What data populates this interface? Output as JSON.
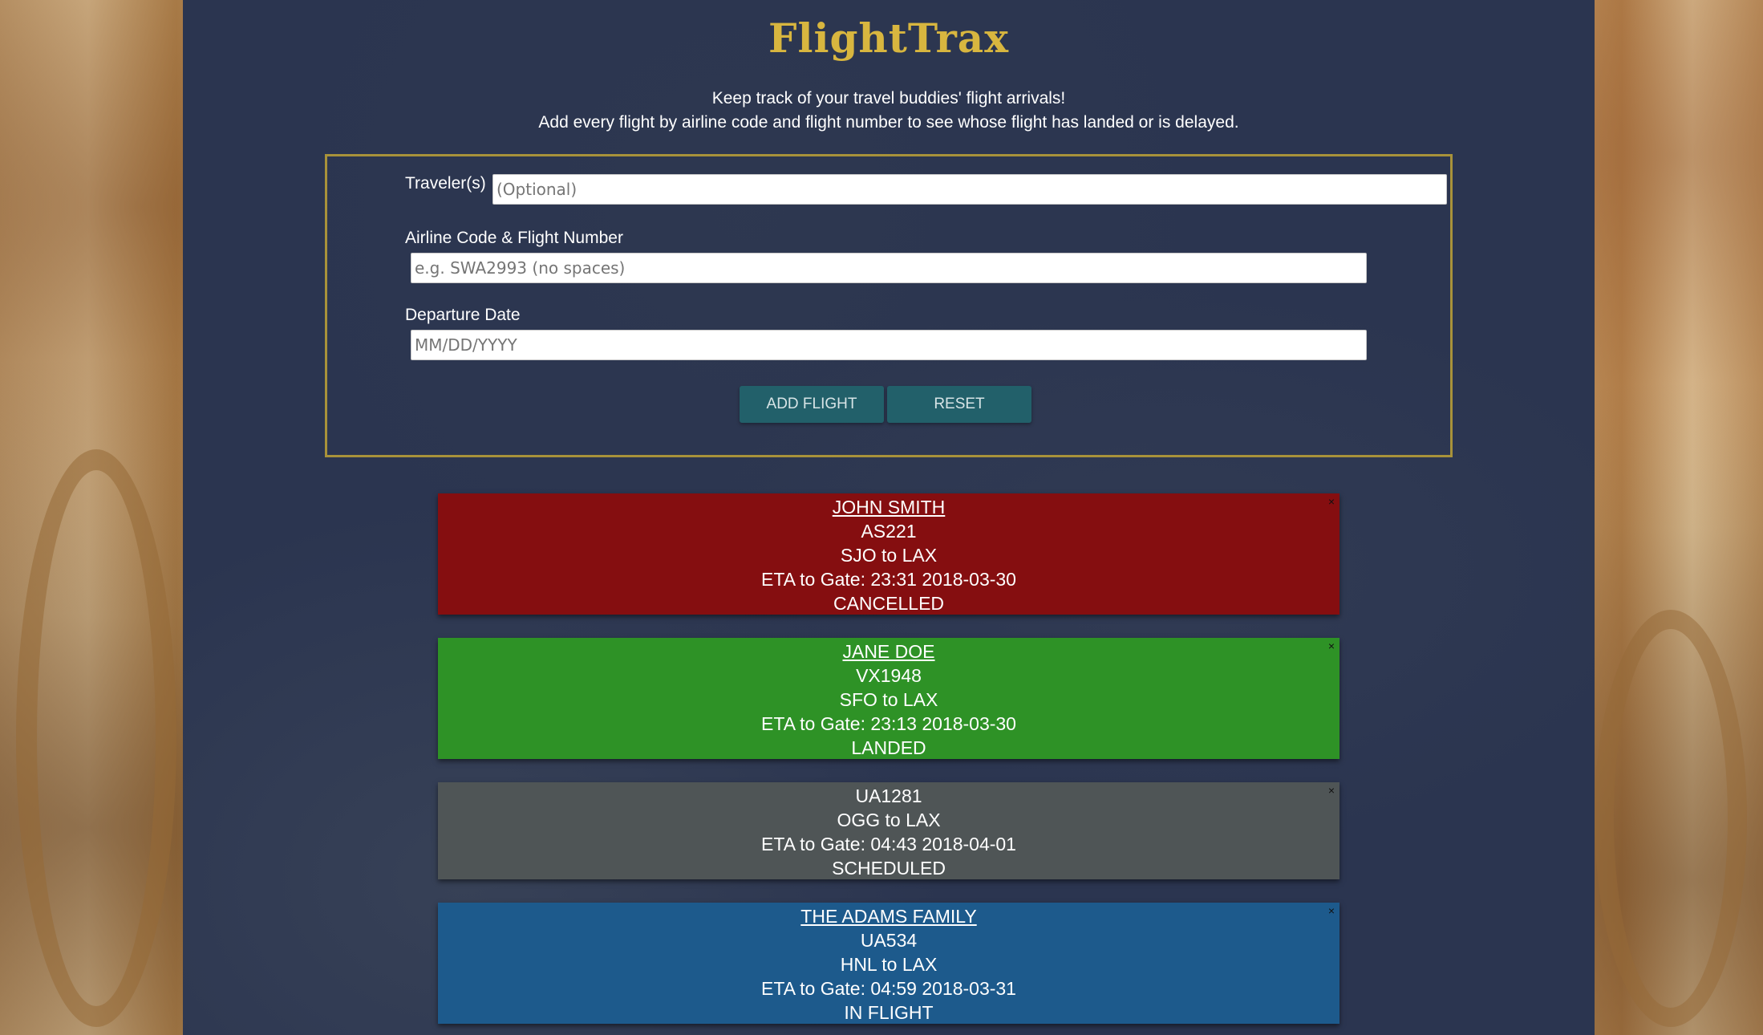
{
  "app": {
    "title": "FlightTrax",
    "subtitle_line1": "Keep track of your travel buddies' flight arrivals!",
    "subtitle_line2": "Add every flight by airline code and flight number to see whose flight has landed or is delayed."
  },
  "form": {
    "traveler_label": "Traveler(s)",
    "traveler_placeholder": "(Optional)",
    "flight_label": "Airline Code & Flight Number",
    "flight_placeholder": "e.g. SWA2993 (no spaces)",
    "date_label": "Departure Date",
    "date_placeholder": "MM/DD/YYYY",
    "add_button": "ADD FLIGHT",
    "reset_button": "RESET"
  },
  "flights": [
    {
      "traveler": "JOHN SMITH",
      "flight": "AS221",
      "route": "SJO to LAX",
      "eta": "ETA to Gate: 23:31 2018-03-30",
      "status": "CANCELLED",
      "color": "#850e10",
      "close": "×"
    },
    {
      "traveler": "JANE DOE",
      "flight": "VX1948",
      "route": "SFO to LAX",
      "eta": "ETA to Gate: 23:13 2018-03-30",
      "status": "LANDED",
      "color": "#2e9226",
      "close": "×"
    },
    {
      "traveler": "",
      "flight": "UA1281",
      "route": "OGG to LAX",
      "eta": "ETA to Gate: 04:43 2018-04-01",
      "status": "SCHEDULED",
      "color": "#4f5556",
      "close": "×"
    },
    {
      "traveler": "THE ADAMS FAMILY",
      "flight": "UA534",
      "route": "HNL to LAX",
      "eta": "ETA to Gate: 04:59 2018-03-31",
      "status": "IN FLIGHT",
      "color": "#1d5a8c",
      "close": "×"
    }
  ]
}
